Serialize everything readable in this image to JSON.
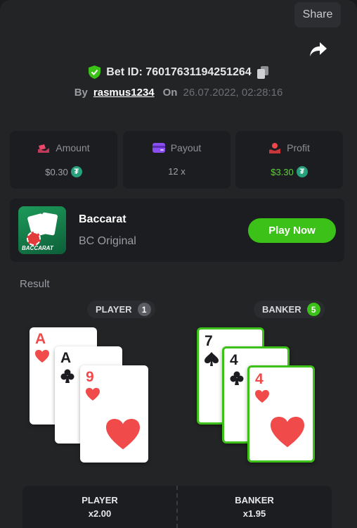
{
  "header": {
    "share_label": "Share"
  },
  "bet": {
    "id_text": "Bet ID: 76017631194251264",
    "by_label": "By",
    "username": "rasmus1234",
    "on_label": "On",
    "date": "26.07.2022, 02:28:16"
  },
  "stats": {
    "amount": {
      "label": "Amount",
      "value": "$0.30"
    },
    "payout": {
      "label": "Payout",
      "value": "12 x"
    },
    "profit": {
      "label": "Profit",
      "value": "$3.30"
    }
  },
  "game": {
    "name": "Baccarat",
    "subtitle": "BC Original",
    "thumb_text": "BACCARAT",
    "play_label": "Play Now"
  },
  "result": {
    "label": "Result",
    "player": {
      "label": "PLAYER",
      "score": "1",
      "cards": [
        {
          "rank": "A",
          "suit": "hearts"
        },
        {
          "rank": "A",
          "suit": "clubs"
        },
        {
          "rank": "9",
          "suit": "hearts"
        }
      ]
    },
    "banker": {
      "label": "BANKER",
      "score": "5",
      "cards": [
        {
          "rank": "7",
          "suit": "spades"
        },
        {
          "rank": "4",
          "suit": "clubs"
        },
        {
          "rank": "4",
          "suit": "hearts"
        }
      ]
    }
  },
  "odds": {
    "player": {
      "label": "PLAYER",
      "value": "x2.00"
    },
    "banker": {
      "label": "BANKER",
      "value": "x1.95"
    }
  },
  "colors": {
    "accent_green": "#3bc117",
    "heart_red": "#f04a4a",
    "tether_green": "#26a17b"
  }
}
